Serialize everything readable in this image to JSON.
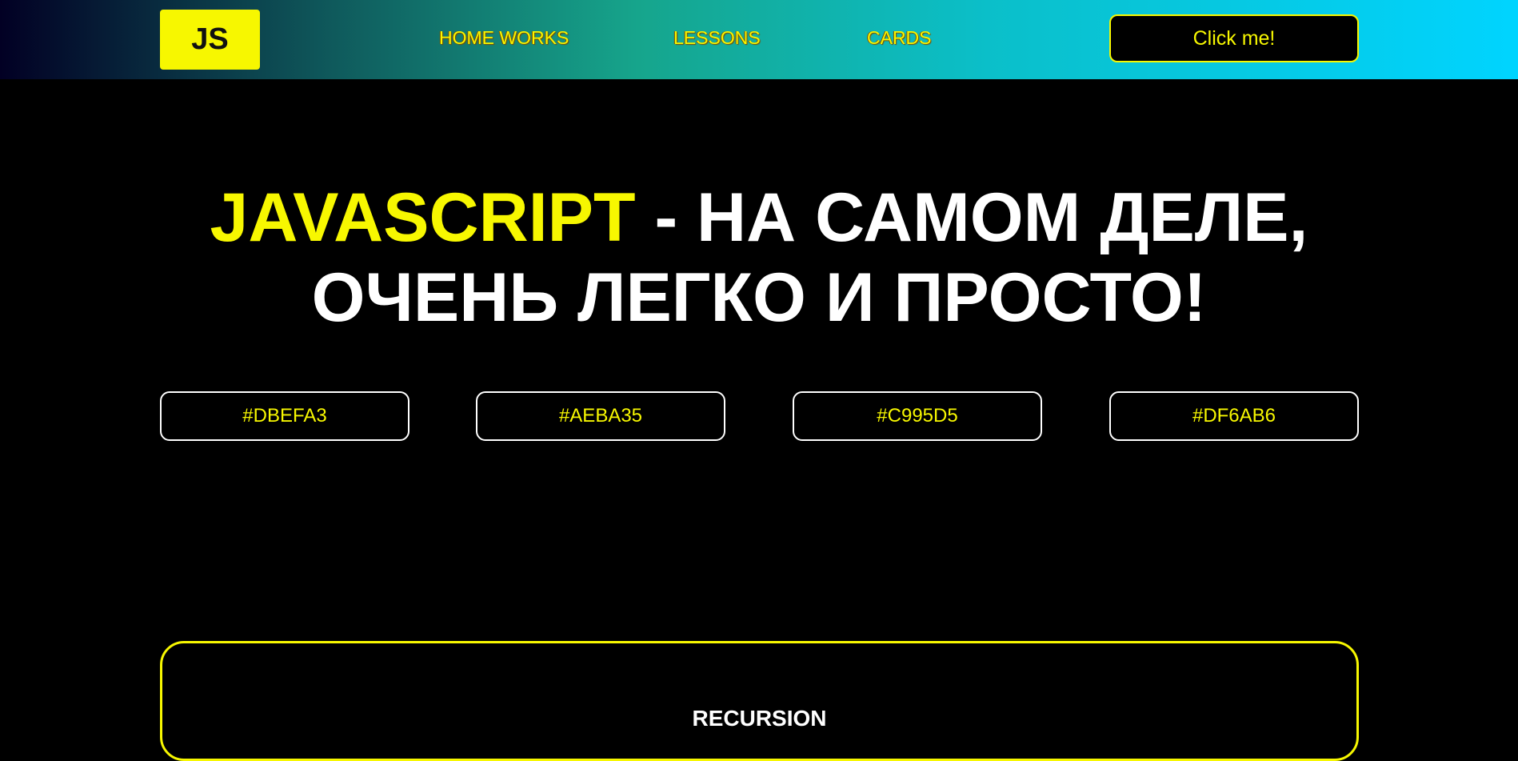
{
  "header": {
    "logo": "JS",
    "nav": [
      "HOME WORKS",
      "LESSONS",
      "CARDS"
    ],
    "cta_label": "Click me!"
  },
  "hero": {
    "accent": "JAVASCRIPT",
    "rest_line1": " - НА САМОМ ДЕЛЕ,",
    "line2": "ОЧЕНЬ ЛЕГКО И ПРОСТО!"
  },
  "color_buttons": [
    "#DBEFA3",
    "#AEBA35",
    "#C995D5",
    "#DF6AB6"
  ],
  "card": {
    "title": "RECURSION"
  },
  "colors": {
    "accent": "#f7f700",
    "background": "#000000",
    "header_gradient_start": "#020024",
    "header_gradient_end": "#00d4ff"
  }
}
